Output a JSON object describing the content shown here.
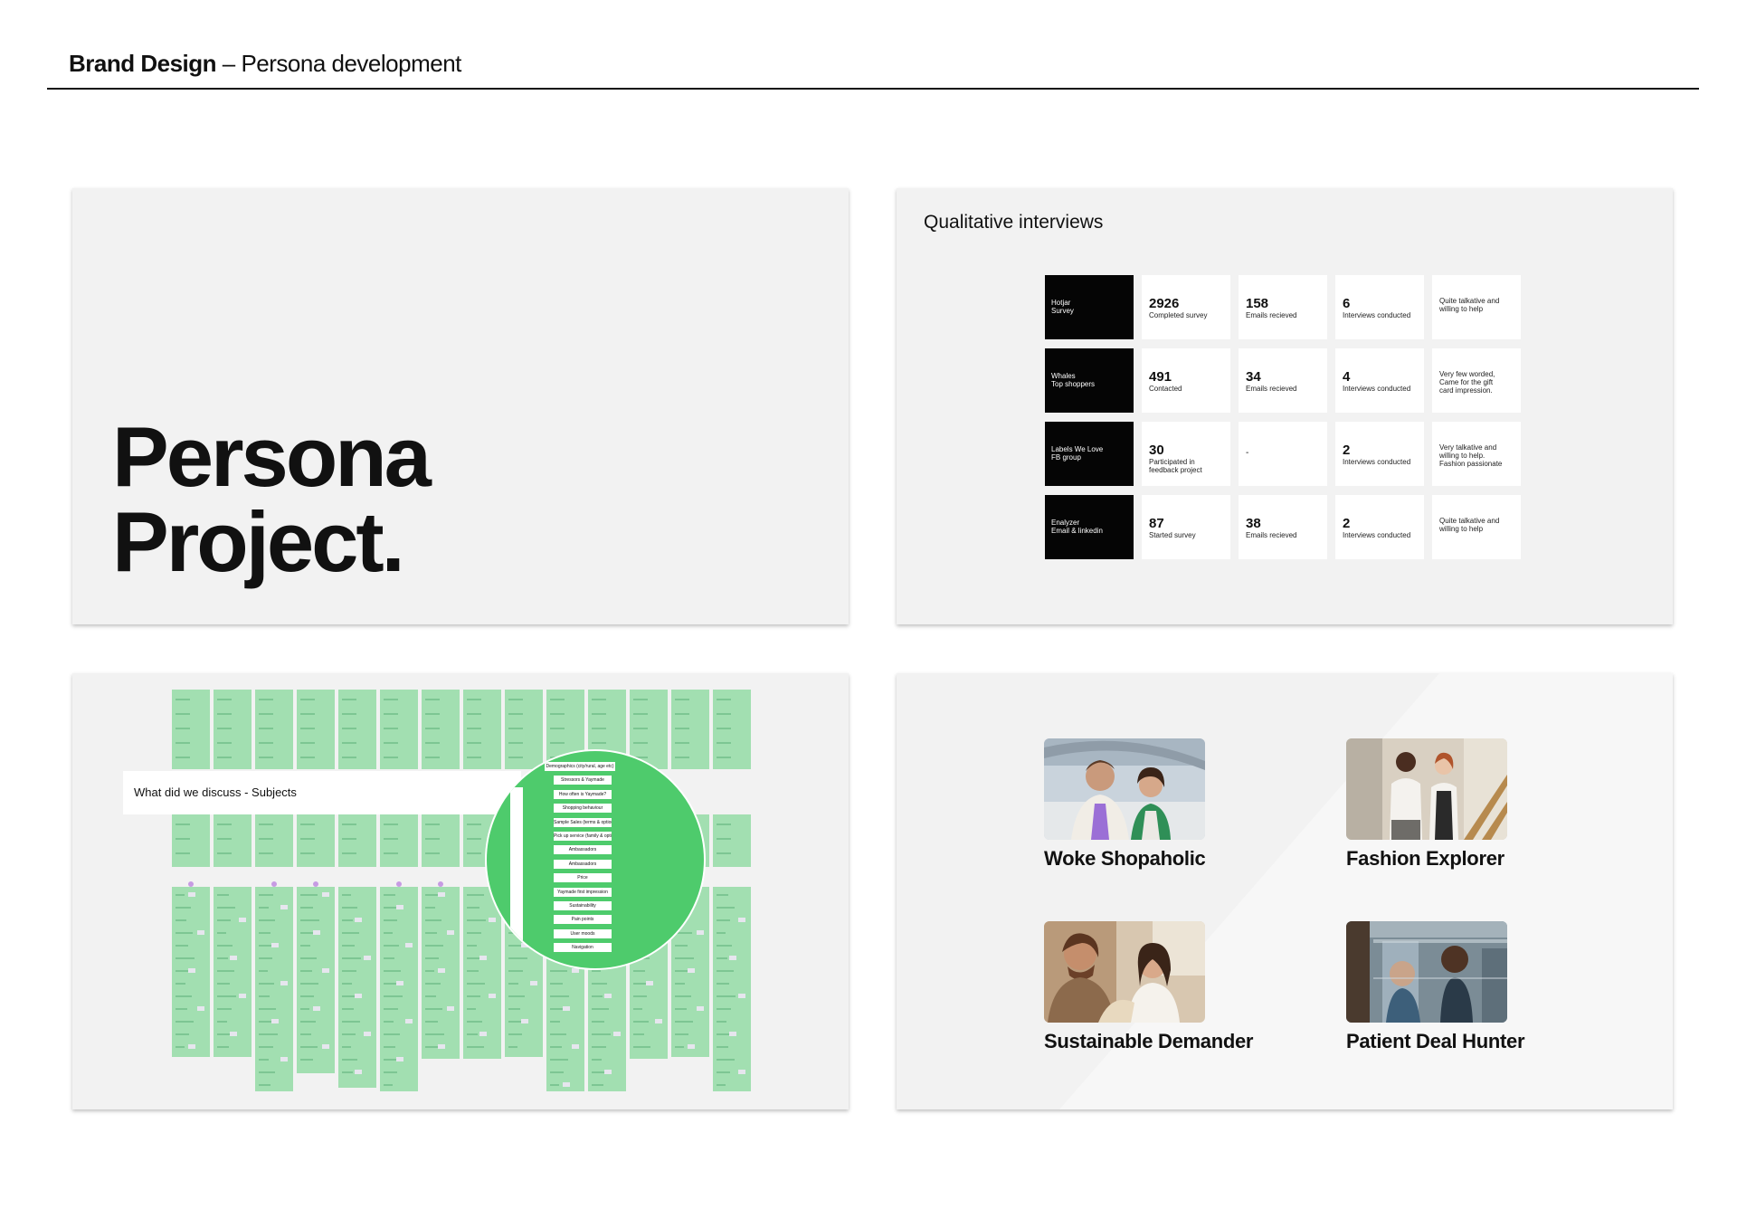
{
  "header": {
    "strong": "Brand Design",
    "rest": " – Persona development"
  },
  "slide1": {
    "line1": "Persona",
    "line2": "Project."
  },
  "slide2": {
    "title": "Qualitative interviews",
    "rows": [
      {
        "label": "Hotjar\nSurvey",
        "c1_num": "2926",
        "c1_sub": "Completed survey",
        "c2_num": "158",
        "c2_sub": "Emails recieved",
        "c3_num": "6",
        "c3_sub": "Interviews conducted",
        "note": "Quite talkative and\nwilling to help"
      },
      {
        "label": "Whales\nTop shoppers",
        "c1_num": "491",
        "c1_sub": "Contacted",
        "c2_num": "34",
        "c2_sub": "Emails recieved",
        "c3_num": "4",
        "c3_sub": "Interviews conducted",
        "note": "Very few worded,\nCame for the gift\ncard impression."
      },
      {
        "label": "Labels We Love\nFB group",
        "c1_num": "30",
        "c1_sub": "Participated in feedback project",
        "c2_num": "",
        "c2_sub": "-",
        "c3_num": "2",
        "c3_sub": "Interviews conducted",
        "note": "Very talkative and\nwilling to help.\nFashion passionate"
      },
      {
        "label": "Enalyzer\nEmail & linkedin",
        "c1_num": "87",
        "c1_sub": "Started survey",
        "c2_num": "38",
        "c2_sub": "Emails recieved",
        "c3_num": "2",
        "c3_sub": "Interviews conducted",
        "note": "Quite talkative and\nwilling to help"
      }
    ]
  },
  "slide3": {
    "label": "What did we discuss - Subjects",
    "subjects": [
      "Demographics (city/rural, age etc)",
      "Stressors & Yaymade",
      "How often is Yaymade?",
      "Shopping behaviour",
      "Sample Sales (terms & options)",
      "Pick up service (family & options)",
      "Ambassadors",
      "Ambassadors",
      "Price",
      "Yaymade first impression",
      "Sustainability",
      "Pain points",
      "User moods",
      "Navigation"
    ]
  },
  "slide4": {
    "personas": [
      {
        "name": "Woke Shopaholic"
      },
      {
        "name": "Fashion Explorer"
      },
      {
        "name": "Sustainable Demander"
      },
      {
        "name": "Patient Deal Hunter"
      }
    ]
  }
}
